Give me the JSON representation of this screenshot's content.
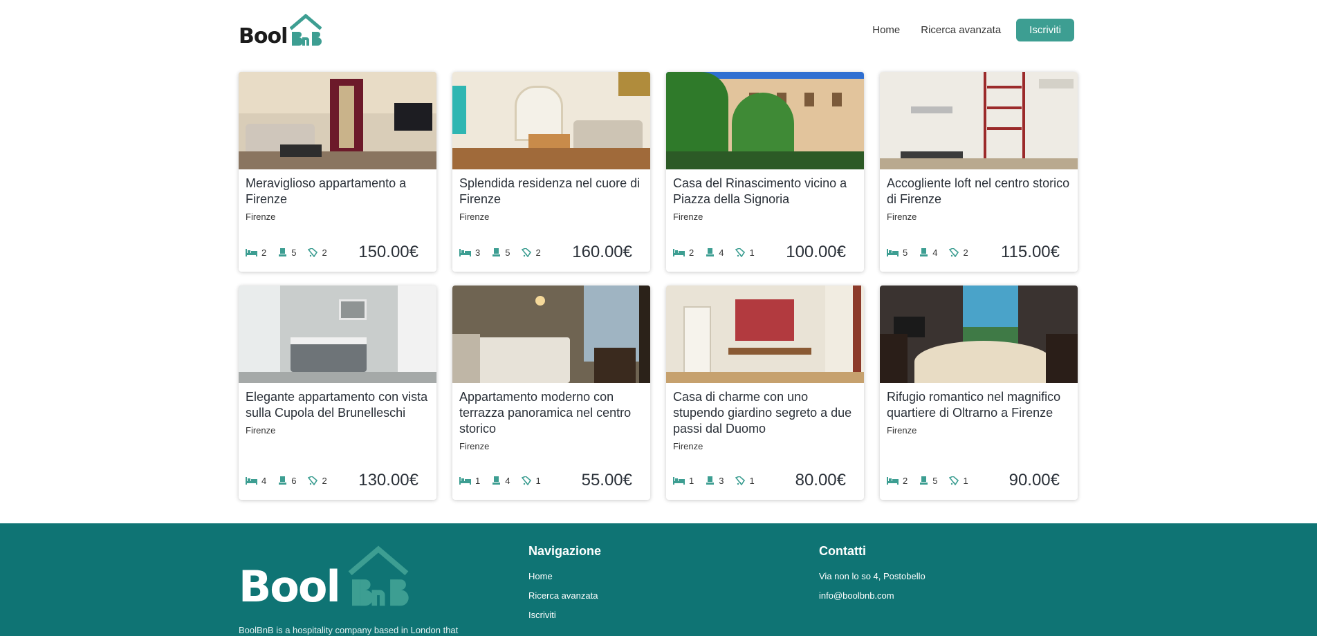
{
  "header": {
    "logo_text": "Bool",
    "nav": {
      "home": "Home",
      "search": "Ricerca avanzata",
      "signup": "Iscriviti"
    }
  },
  "colors": {
    "accent": "#3d9e92",
    "footer_bg": "#0f7474",
    "logo_green": "#3d9e92"
  },
  "icons": {
    "rooms": "bed-icon",
    "beds": "person-icon",
    "baths": "shower-icon"
  },
  "apartments": [
    {
      "title": "Meraviglioso appartamento a Firenze",
      "city": "Firenze",
      "rooms": "2",
      "beds": "5",
      "baths": "2",
      "price": "150.00€"
    },
    {
      "title": "Splendida residenza nel cuore di Firenze",
      "city": "Firenze",
      "rooms": "3",
      "beds": "5",
      "baths": "2",
      "price": "160.00€"
    },
    {
      "title": "Casa del Rinascimento vicino a Piazza della Signoria",
      "city": "Firenze",
      "rooms": "2",
      "beds": "4",
      "baths": "1",
      "price": "100.00€"
    },
    {
      "title": "Accogliente loft nel centro storico di Firenze",
      "city": "Firenze",
      "rooms": "5",
      "beds": "4",
      "baths": "2",
      "price": "115.00€"
    },
    {
      "title": "Elegante appartamento con vista sulla Cupola del Brunelleschi",
      "city": "Firenze",
      "rooms": "4",
      "beds": "6",
      "baths": "2",
      "price": "130.00€"
    },
    {
      "title": "Appartamento moderno con terrazza panoramica nel centro storico",
      "city": "Firenze",
      "rooms": "1",
      "beds": "4",
      "baths": "1",
      "price": "55.00€"
    },
    {
      "title": "Casa di charme con uno stupendo giardino segreto a due passi dal Duomo",
      "city": "Firenze",
      "rooms": "1",
      "beds": "3",
      "baths": "1",
      "price": "80.00€"
    },
    {
      "title": "Rifugio romantico nel magnifico quartiere di Oltrarno a Firenze",
      "city": "Firenze",
      "rooms": "2",
      "beds": "5",
      "baths": "1",
      "price": "90.00€"
    }
  ],
  "footer": {
    "logo_text": "Bool",
    "about": "BoolBnB is a hospitality company based in London that",
    "nav_title": "Navigazione",
    "nav_links": [
      "Home",
      "Ricerca avanzata",
      "Iscriviti"
    ],
    "contact_title": "Contatti",
    "address": "Via non lo so 4, Postobello",
    "email": "info@boolbnb.com"
  }
}
